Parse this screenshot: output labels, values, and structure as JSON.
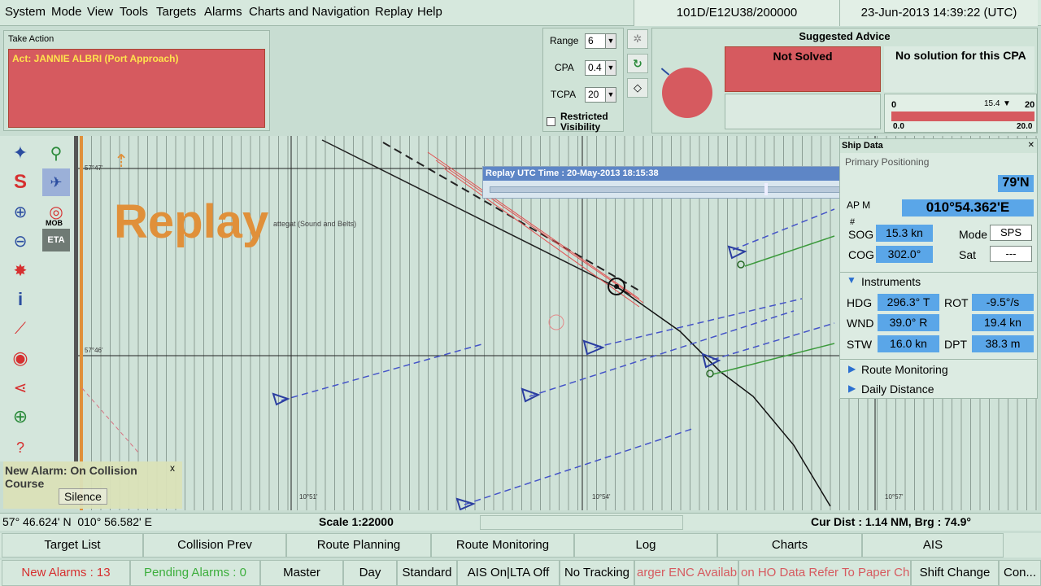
{
  "menu": [
    "System",
    "Mode",
    "View",
    "Tools",
    "Targets",
    "Alarms",
    "Charts and Navigation",
    "Replay",
    "Help"
  ],
  "header": {
    "chart_id": "101D/E12U38/200000",
    "datetime": "23-Jun-2013 14:39:22 (UTC)"
  },
  "take_action": {
    "title": "Take Action",
    "message": "Act: JANNIE ALBRI (Port Approach)"
  },
  "cpa_settings": {
    "range_label": "Range",
    "range_value": "6",
    "cpa_label": "CPA",
    "cpa_value": "0.4",
    "tcpa_label": "TCPA",
    "tcpa_value": "20",
    "restricted_label_1": "Restricted",
    "restricted_label_2": "Visibility"
  },
  "advice": {
    "title": "Suggested Advice",
    "status": "Not Solved",
    "message": "No solution for this CPA",
    "scale_min": "0",
    "scale_marker": "15.4",
    "scale_max": "20",
    "scale_min2": "0.0",
    "scale_max2": "20.0"
  },
  "replay_watermark": "Replay",
  "replay_dialog": {
    "title": "Replay UTC Time : 20-May-2013 18:15:38"
  },
  "toolbar": {
    "mob_label": "MOB",
    "eta_label": "ETA"
  },
  "alarm_popup": {
    "text": "New Alarm: On Collision Course",
    "silence": "Silence",
    "close": "x"
  },
  "chart_labels": {
    "lat_top": "57°47'",
    "lat_mid": "57°46'",
    "lon_1": "10°51'",
    "lon_2": "10°54'",
    "lon_3": "10°57'",
    "area_name": "attegat (Sound and Belts)"
  },
  "ship_data": {
    "title": "Ship Data",
    "primary": "Primary Positioning",
    "lat_partial": "79'N",
    "ap_label": "AP M",
    "lon": "010°54.362'E",
    "hash": "#",
    "sog_label": "SOG",
    "sog": "15.3 kn",
    "mode_label": "Mode",
    "mode": "SPS",
    "cog_label": "COG",
    "cog": "302.0°",
    "sat_label": "Sat",
    "sat": "---",
    "instruments": "Instruments",
    "hdg_label": "HDG",
    "hdg": "296.3° T",
    "rot_label": "ROT",
    "rot": "-9.5°/s",
    "wnd_label": "WND",
    "wnd": "39.0° R",
    "wnd_speed": "19.4 kn",
    "stw_label": "STW",
    "stw": "16.0 kn",
    "dpt_label": "DPT",
    "dpt": "38.3 m",
    "route_monitoring": "Route Monitoring",
    "daily_distance": "Daily Distance"
  },
  "status": {
    "position": "57° 46.624' N  010° 56.582' E",
    "scale": "Scale 1:22000",
    "cur_dist": "Cur Dist : 1.14 NM, Brg : 74.9°"
  },
  "tabs": [
    "Target List",
    "Collision Prev",
    "Route Planning",
    "Route Monitoring",
    "Log",
    "Charts",
    "AIS"
  ],
  "alarms": {
    "new_alarms": "New Alarms : 13",
    "pending": "Pending Alarms : 0",
    "master": "Master",
    "day": "Day",
    "standard": "Standard",
    "ais": "AIS On|LTA Off",
    "tracking": "No Tracking",
    "enc": "arger ENC Availabl",
    "ho": "on HO Data Refer To Paper Cha",
    "shift": "Shift Change",
    "con": "Con..."
  },
  "colors": {
    "alert_red": "#d65a5f",
    "value_blue": "#5aa6e8",
    "replay_orange": "#e0903a"
  }
}
